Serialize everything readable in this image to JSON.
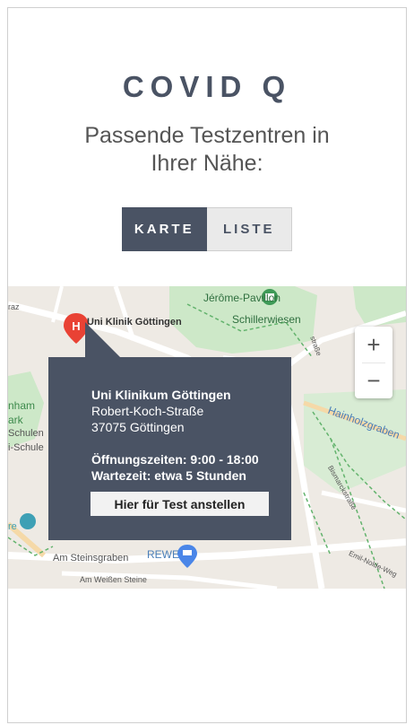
{
  "header": {
    "title": "COVID Q",
    "subtitle_line1": "Passende Testzentren in",
    "subtitle_line2": "Ihrer Nähe:"
  },
  "view_toggle": {
    "map_label": "KARTE",
    "list_label": "LISTE",
    "selected": "KARTE"
  },
  "map": {
    "labels": {
      "hospital": "Uni Klinik Göttingen",
      "jerome": "Jérôme-Pavillon",
      "schillerwiesen": "Schillerwiesen",
      "hainholzgraben": "Hainholzgraben",
      "steinsgraben": "Am Steinsgraben",
      "rewe": "REWE",
      "weissen_steine": "Am Weißen Steine",
      "schulen": "Schulen",
      "schule": "i-Schule",
      "nham": "nham",
      "ark": "ark",
      "raz": "raz",
      "re": "re",
      "bismarck": "Bismarckstraße",
      "emil": "Emil-Nolde-Weg",
      "strasse": "straße"
    },
    "zoom_in": "+",
    "zoom_out": "−"
  },
  "popup": {
    "name": "Uni Klinikum Göttingen",
    "street": "Robert-Koch-Straße",
    "city": "37075 Göttingen",
    "hours": "Öffnungszeiten: 9:00 - 18:00",
    "wait": "Wartezeit: etwa 5 Stunden",
    "button": "Hier für Test anstellen"
  },
  "colors": {
    "accent": "#4a5364",
    "park": "#cde8c8",
    "map_bg": "#eeeae4"
  },
  "icons": {
    "hospital": "hospital-marker-icon",
    "poi": "landmark-icon",
    "shop": "shopping-cart-icon"
  }
}
